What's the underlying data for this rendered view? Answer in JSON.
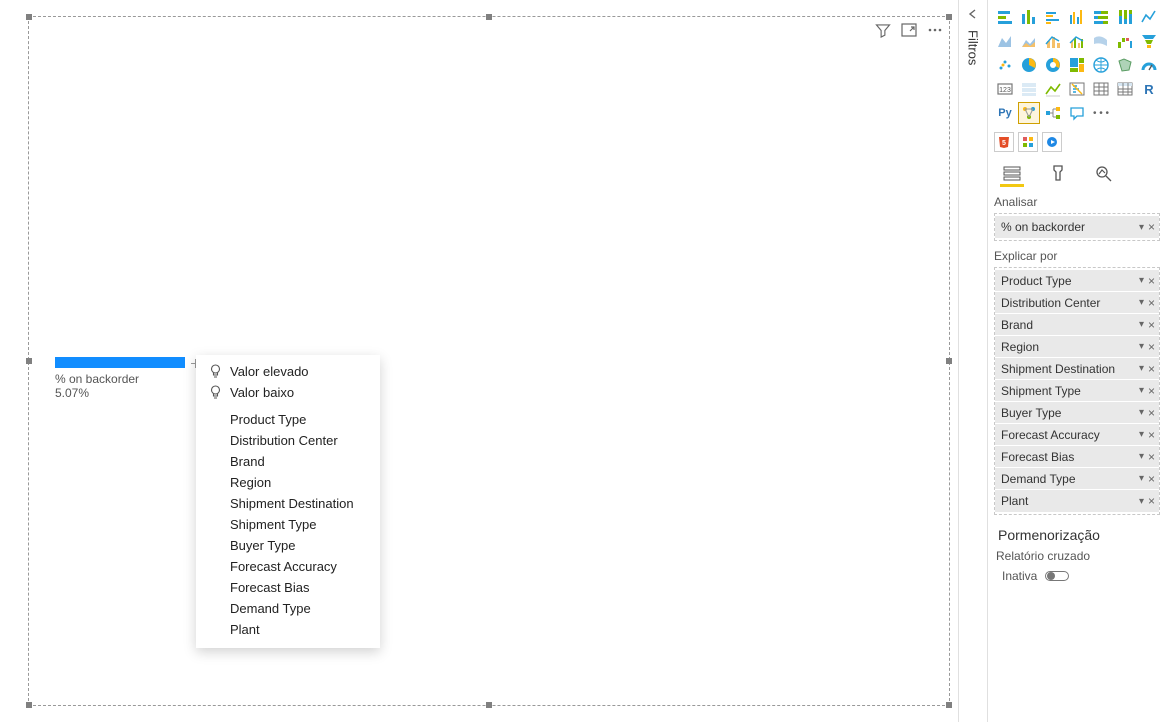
{
  "chart_data": {
    "type": "bar",
    "categories": [
      "% on backorder"
    ],
    "values": [
      5.07
    ],
    "title": "",
    "xlabel": "",
    "ylabel": ""
  },
  "visual": {
    "label": "% on backorder",
    "value": "5.07%"
  },
  "menu": {
    "valor_elevado": "Valor elevado",
    "valor_baixo": "Valor baixo",
    "categories": [
      "Product Type",
      "Distribution Center",
      "Brand",
      "Region",
      "Shipment Destination",
      "Shipment Type",
      "Buyer Type",
      "Forecast Accuracy",
      "Forecast Bias",
      "Demand Type",
      "Plant"
    ]
  },
  "filters_rail": {
    "label": "Filtros"
  },
  "viz_pane": {
    "tabs": {
      "analise": "Analisar"
    },
    "analisar_label": "Analisar",
    "analisar_field": "% on backorder",
    "explicar_label": "Explicar por",
    "explicar_fields": [
      "Product Type",
      "Distribution Center",
      "Brand",
      "Region",
      "Shipment Destination",
      "Shipment Type",
      "Buyer Type",
      "Forecast Accuracy",
      "Forecast Bias",
      "Demand Type",
      "Plant"
    ],
    "drill": {
      "heading": "Pormenorização",
      "cross": "Relatório cruzado",
      "inativa": "Inativa"
    },
    "r_label": "R",
    "py_label": "Py",
    "dots": "• • •"
  }
}
